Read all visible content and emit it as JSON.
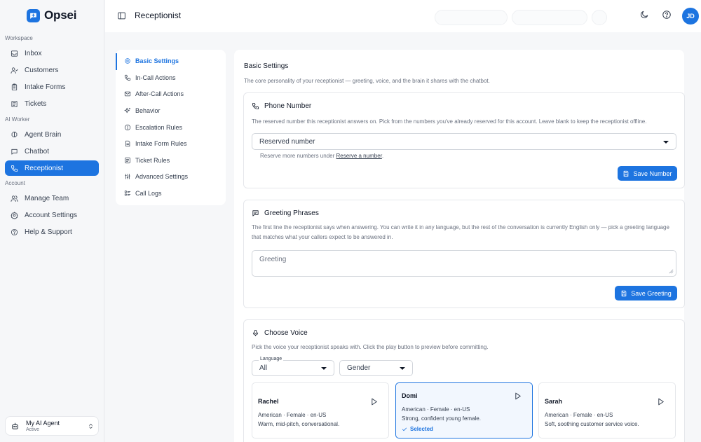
{
  "app": {
    "name": "Opsei",
    "brand_color": "#1d74e0"
  },
  "sidebar": {
    "sections": [
      {
        "label": "Workspace",
        "items": [
          {
            "label": "Inbox",
            "icon": "inbox-icon"
          },
          {
            "label": "Customers",
            "icon": "users-icon"
          },
          {
            "label": "Intake Forms",
            "icon": "clipboard-icon"
          },
          {
            "label": "Tickets",
            "icon": "ticket-icon"
          }
        ]
      },
      {
        "label": "AI Worker",
        "items": [
          {
            "label": "Agent Brain",
            "icon": "brain-icon"
          },
          {
            "label": "Chatbot",
            "icon": "chat-icon"
          },
          {
            "label": "Receptionist",
            "icon": "phone-icon",
            "active": true
          }
        ]
      },
      {
        "label": "Account",
        "items": [
          {
            "label": "Manage Team",
            "icon": "team-icon"
          },
          {
            "label": "Account Settings",
            "icon": "gear-icon"
          },
          {
            "label": "Help & Support",
            "icon": "help-icon"
          }
        ]
      }
    ],
    "agent": {
      "name": "My AI Agent",
      "status": "Active"
    }
  },
  "header": {
    "title": "Receptionist",
    "avatar_initials": "JD"
  },
  "subnav": {
    "items": [
      {
        "label": "Basic Settings",
        "icon": "settings-icon",
        "active": true
      },
      {
        "label": "In-Call Actions",
        "icon": "phone-icon"
      },
      {
        "label": "After-Call Actions",
        "icon": "mail-icon"
      },
      {
        "label": "Behavior",
        "icon": "sparkle-icon"
      },
      {
        "label": "Escalation Rules",
        "icon": "alert-icon"
      },
      {
        "label": "Intake Form Rules",
        "icon": "document-icon"
      },
      {
        "label": "Ticket Rules",
        "icon": "ticket-icon"
      },
      {
        "label": "Advanced Settings",
        "icon": "sliders-icon"
      },
      {
        "label": "Call Logs",
        "icon": "list-icon"
      }
    ]
  },
  "main": {
    "title": "Basic Settings",
    "description": "The core personality of your receptionist — greeting, voice, and the brain it shares with the chatbot.",
    "phone_card": {
      "title": "Phone Number",
      "description": "The reserved number this receptionist answers on. Pick from the numbers you've already reserved for this account. Leave blank to keep the receptionist offline.",
      "select_placeholder": "Reserved number",
      "note_prefix": "Reserve more numbers under ",
      "note_link": "Reserve a number",
      "note_suffix": ".",
      "save_label": "Save Number"
    },
    "greeting_card": {
      "title": "Greeting Phrases",
      "description_line1": "The first line the receptionist says when answering. You can write it in any language, but the rest of the conversation is currently English only — pick a greeting language",
      "description_line2": "that matches what your callers expect to be answered in.",
      "placeholder": "Greeting",
      "save_label": "Save Greeting"
    },
    "voice_card": {
      "title": "Choose Voice",
      "description": "Pick the voice your receptionist speaks with. Click the play button to preview before committing.",
      "language_label": "Language",
      "language_value": "All",
      "gender_placeholder": "Gender",
      "selected_label": "Selected",
      "voices": [
        {
          "name": "Rachel",
          "meta": "American · Female · en-US",
          "desc": "Warm, mid-pitch, conversational."
        },
        {
          "name": "Domi",
          "meta": "American · Female · en-US",
          "desc": "Strong, confident young female.",
          "selected": true
        },
        {
          "name": "Sarah",
          "meta": "American · Female · en-US",
          "desc": "Soft, soothing customer service voice."
        }
      ]
    }
  }
}
